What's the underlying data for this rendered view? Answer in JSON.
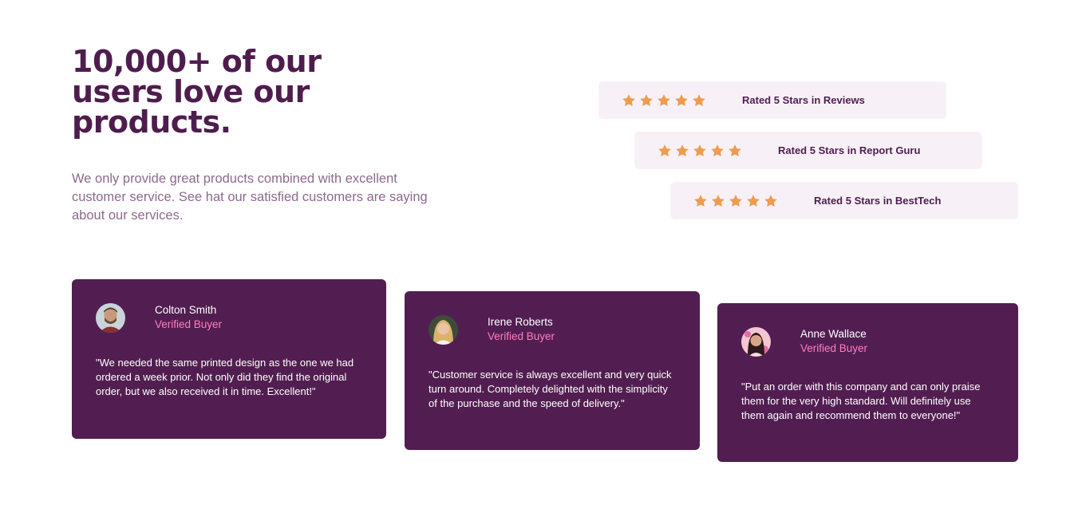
{
  "hero": {
    "title": "10,000+ of our users love our products.",
    "intro": "We only provide great products combined with excellent customer service. See hat our satisfied customers are saying about our services."
  },
  "ratings": [
    {
      "label": "Rated 5 Stars in Reviews",
      "stars": 5
    },
    {
      "label": "Rated 5 Stars in Report Guru",
      "stars": 5
    },
    {
      "label": "Rated 5 Stars in BestTech",
      "stars": 5
    }
  ],
  "testimonials": [
    {
      "name": "Colton Smith",
      "badge": "Verified Buyer",
      "quote": "\"We needed the same printed design as the one we had ordered a week prior. Not only did they find the original order, but we also received it in time. Excellent!\""
    },
    {
      "name": "Irene Roberts",
      "badge": "Verified Buyer",
      "quote": "\"Customer service is always excellent and very quick turn around. Completely delighted with the simplicity of the purchase and the speed of delivery.\""
    },
    {
      "name": "Anne Wallace",
      "badge": "Verified Buyer",
      "quote": "\"Put an order with this company and can only praise them for the very high standard. Will definitely use them again and recommend them to everyone!\""
    }
  ],
  "colors": {
    "primary": "#4e1d4e",
    "card_bg": "#521e51",
    "rating_bg": "#f7f1f7",
    "star": "#ee9c4f",
    "accent_pink": "#ff7ec0",
    "body_text": "#8c6a8c"
  },
  "icons": {
    "star": "star-icon",
    "avatar": "avatar"
  }
}
